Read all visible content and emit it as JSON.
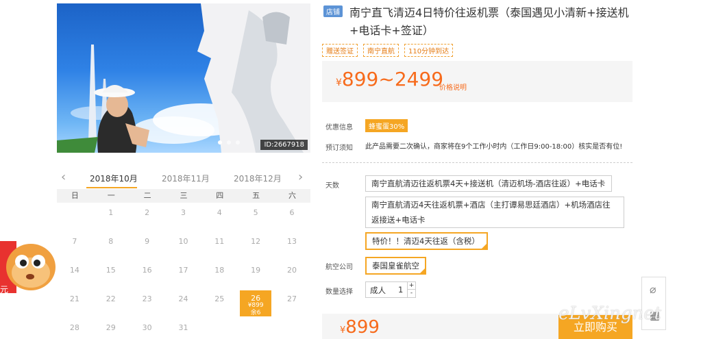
{
  "hero": {
    "id_label": "ID:2667918"
  },
  "product": {
    "badge": "店铺",
    "title": "南宁直飞清迈4日特价往返机票（泰国遇见小清新+接送机+电话卡+签证）",
    "tags": [
      "赠送签证",
      "南宁直航",
      "110分钟到达"
    ]
  },
  "price": {
    "currency": "¥",
    "range": "899~2499",
    "note": "价格说明"
  },
  "discount": {
    "label": "优惠信息",
    "value": "蜂蜜蛋30%"
  },
  "notice": {
    "label": "预订须知",
    "text": "此产品需要二次确认，商家将在9个工作小时内（工作日9:00-18:00）核实是否有位!"
  },
  "options": {
    "days_label": "天数",
    "days": [
      "南宁直航清迈往返机票4天+接送机（清迈机场-酒店往返）+电话卡",
      "南宁直航清迈4天往返机票+酒店（主打谭易思廷酒店）+机场酒店往返接送+电话卡",
      "特价！！清迈4天往返（含税）"
    ],
    "airline_label": "航空公司",
    "airline": "泰国皇雀航空",
    "qty_label": "数量选择",
    "qty_type": "成人",
    "qty_value": "1",
    "up": "+",
    "down": "-"
  },
  "bottom": {
    "currency": "¥",
    "price": "899",
    "buy": "立即购买"
  },
  "calendar": {
    "months": [
      "2018年10月",
      "2018年11月",
      "2018年12月"
    ],
    "weekdays": [
      "日",
      "一",
      "二",
      "三",
      "四",
      "五",
      "六"
    ],
    "days": [
      "",
      "1",
      "2",
      "3",
      "4",
      "5",
      "6",
      "7",
      "8",
      "9",
      "10",
      "11",
      "12",
      "13",
      "14",
      "15",
      "16",
      "17",
      "18",
      "19",
      "20",
      "21",
      "22",
      "23",
      "24",
      "25",
      "26",
      "27",
      "28",
      "29",
      "30",
      "31",
      "",
      "",
      ""
    ],
    "selected": {
      "day": "26",
      "price": "¥899",
      "remain": "余6"
    }
  },
  "promo": {
    "text": "元"
  },
  "watermark": "eLvXingnet",
  "icons": {
    "clip": "⌀",
    "qr": "▦"
  }
}
